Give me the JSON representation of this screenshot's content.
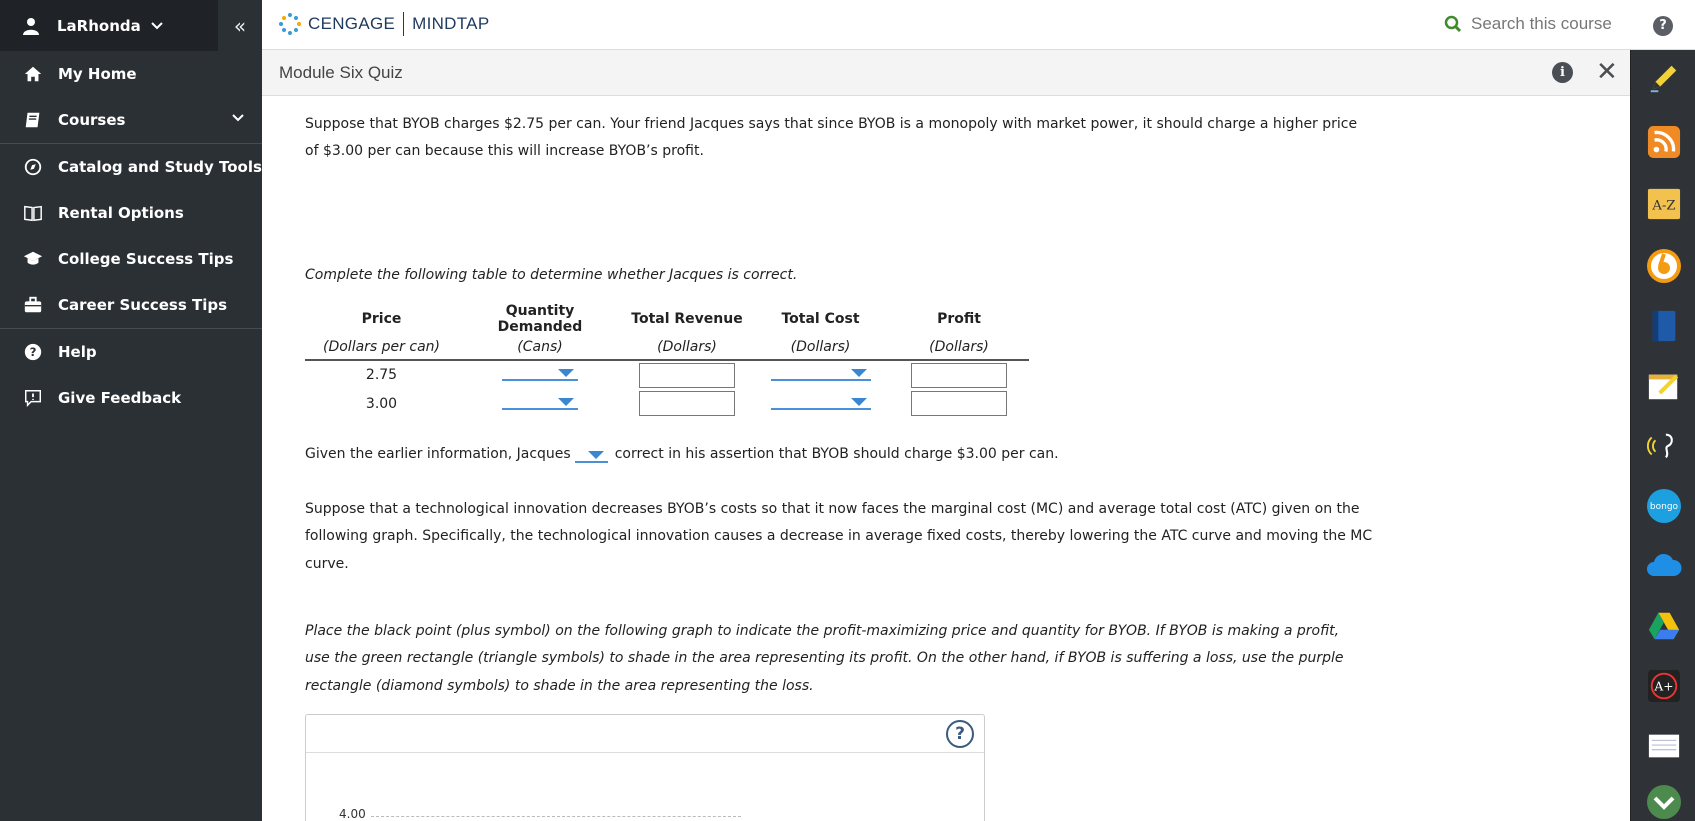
{
  "user": {
    "name": "LaRhonda"
  },
  "sidebar": {
    "collapse_glyph": "«",
    "items": [
      {
        "label": "My Home",
        "icon": "home-icon"
      },
      {
        "label": "Courses",
        "icon": "book-icon"
      },
      {
        "label": "Catalog and Study Tools",
        "icon": "compass-icon"
      },
      {
        "label": "Rental Options",
        "icon": "open-book-icon"
      },
      {
        "label": "College Success Tips",
        "icon": "graduation-cap-icon"
      },
      {
        "label": "Career Success Tips",
        "icon": "briefcase-icon"
      },
      {
        "label": "Help",
        "icon": "question-circle-icon"
      },
      {
        "label": "Give Feedback",
        "icon": "feedback-icon"
      }
    ]
  },
  "topbar": {
    "brand_left": "CENGAGE",
    "brand_right": "MINDTAP",
    "search_placeholder": "Search this course",
    "help_glyph": "?"
  },
  "header": {
    "title": "Module Six Quiz",
    "info_glyph": "i",
    "close_glyph": "✕"
  },
  "dock": {
    "atoz_label": "A-Z",
    "bongo_label": "bongo",
    "aplus_label": "A+",
    "apps": [
      "pencil-icon",
      "rss-icon",
      "a-to-z-icon",
      "readspeaker-icon",
      "dictionary-book-icon",
      "notes-icon",
      "audio-icon",
      "bongo-icon",
      "cloud-icon",
      "google-drive-icon",
      "aplus-icon",
      "notepad-icon",
      "expand-down-icon"
    ]
  },
  "content": {
    "intro": "Suppose that BYOB charges $2.75 per can. Your friend Jacques says that since BYOB is a monopoly with market power, it should charge a higher price",
    "intro2": "of $3.00 per can because this will increase BYOB’s profit.",
    "table_instruction": "Complete the following table to determine whether Jacques is correct.",
    "table": {
      "headers": [
        "Price",
        "Quantity Demanded",
        "Total Revenue",
        "Total Cost",
        "Profit"
      ],
      "units": [
        "(Dollars per can)",
        "(Cans)",
        "(Dollars)",
        "(Dollars)",
        "(Dollars)"
      ],
      "rows": [
        {
          "price": "2.75"
        },
        {
          "price": "3.00"
        }
      ]
    },
    "assertion_before": "Given the earlier information, Jacques",
    "assertion_after": "correct in his assertion that BYOB should charge $3.00 per can.",
    "innovation_1": "Suppose that a technological innovation decreases BYOB’s costs so that it now faces the marginal cost (MC) and average total cost (ATC) given on the",
    "innovation_2": "following graph. Specifically, the technological innovation causes a decrease in average fixed costs, thereby lowering the ATC curve and moving the MC",
    "innovation_3": "curve.",
    "graph_instr_1": "Place the black point (plus symbol) on the following graph to indicate the profit-maximizing price and quantity for BYOB. If BYOB is making a profit,",
    "graph_instr_2": "use the green rectangle (triangle symbols) to shade in the area representing its profit. On the other hand, if BYOB is suffering a loss, use the purple",
    "graph_instr_3": "rectangle (diamond symbols) to shade in the area representing the loss.",
    "graph_help_glyph": "?",
    "graph_y_top": "4.00"
  }
}
